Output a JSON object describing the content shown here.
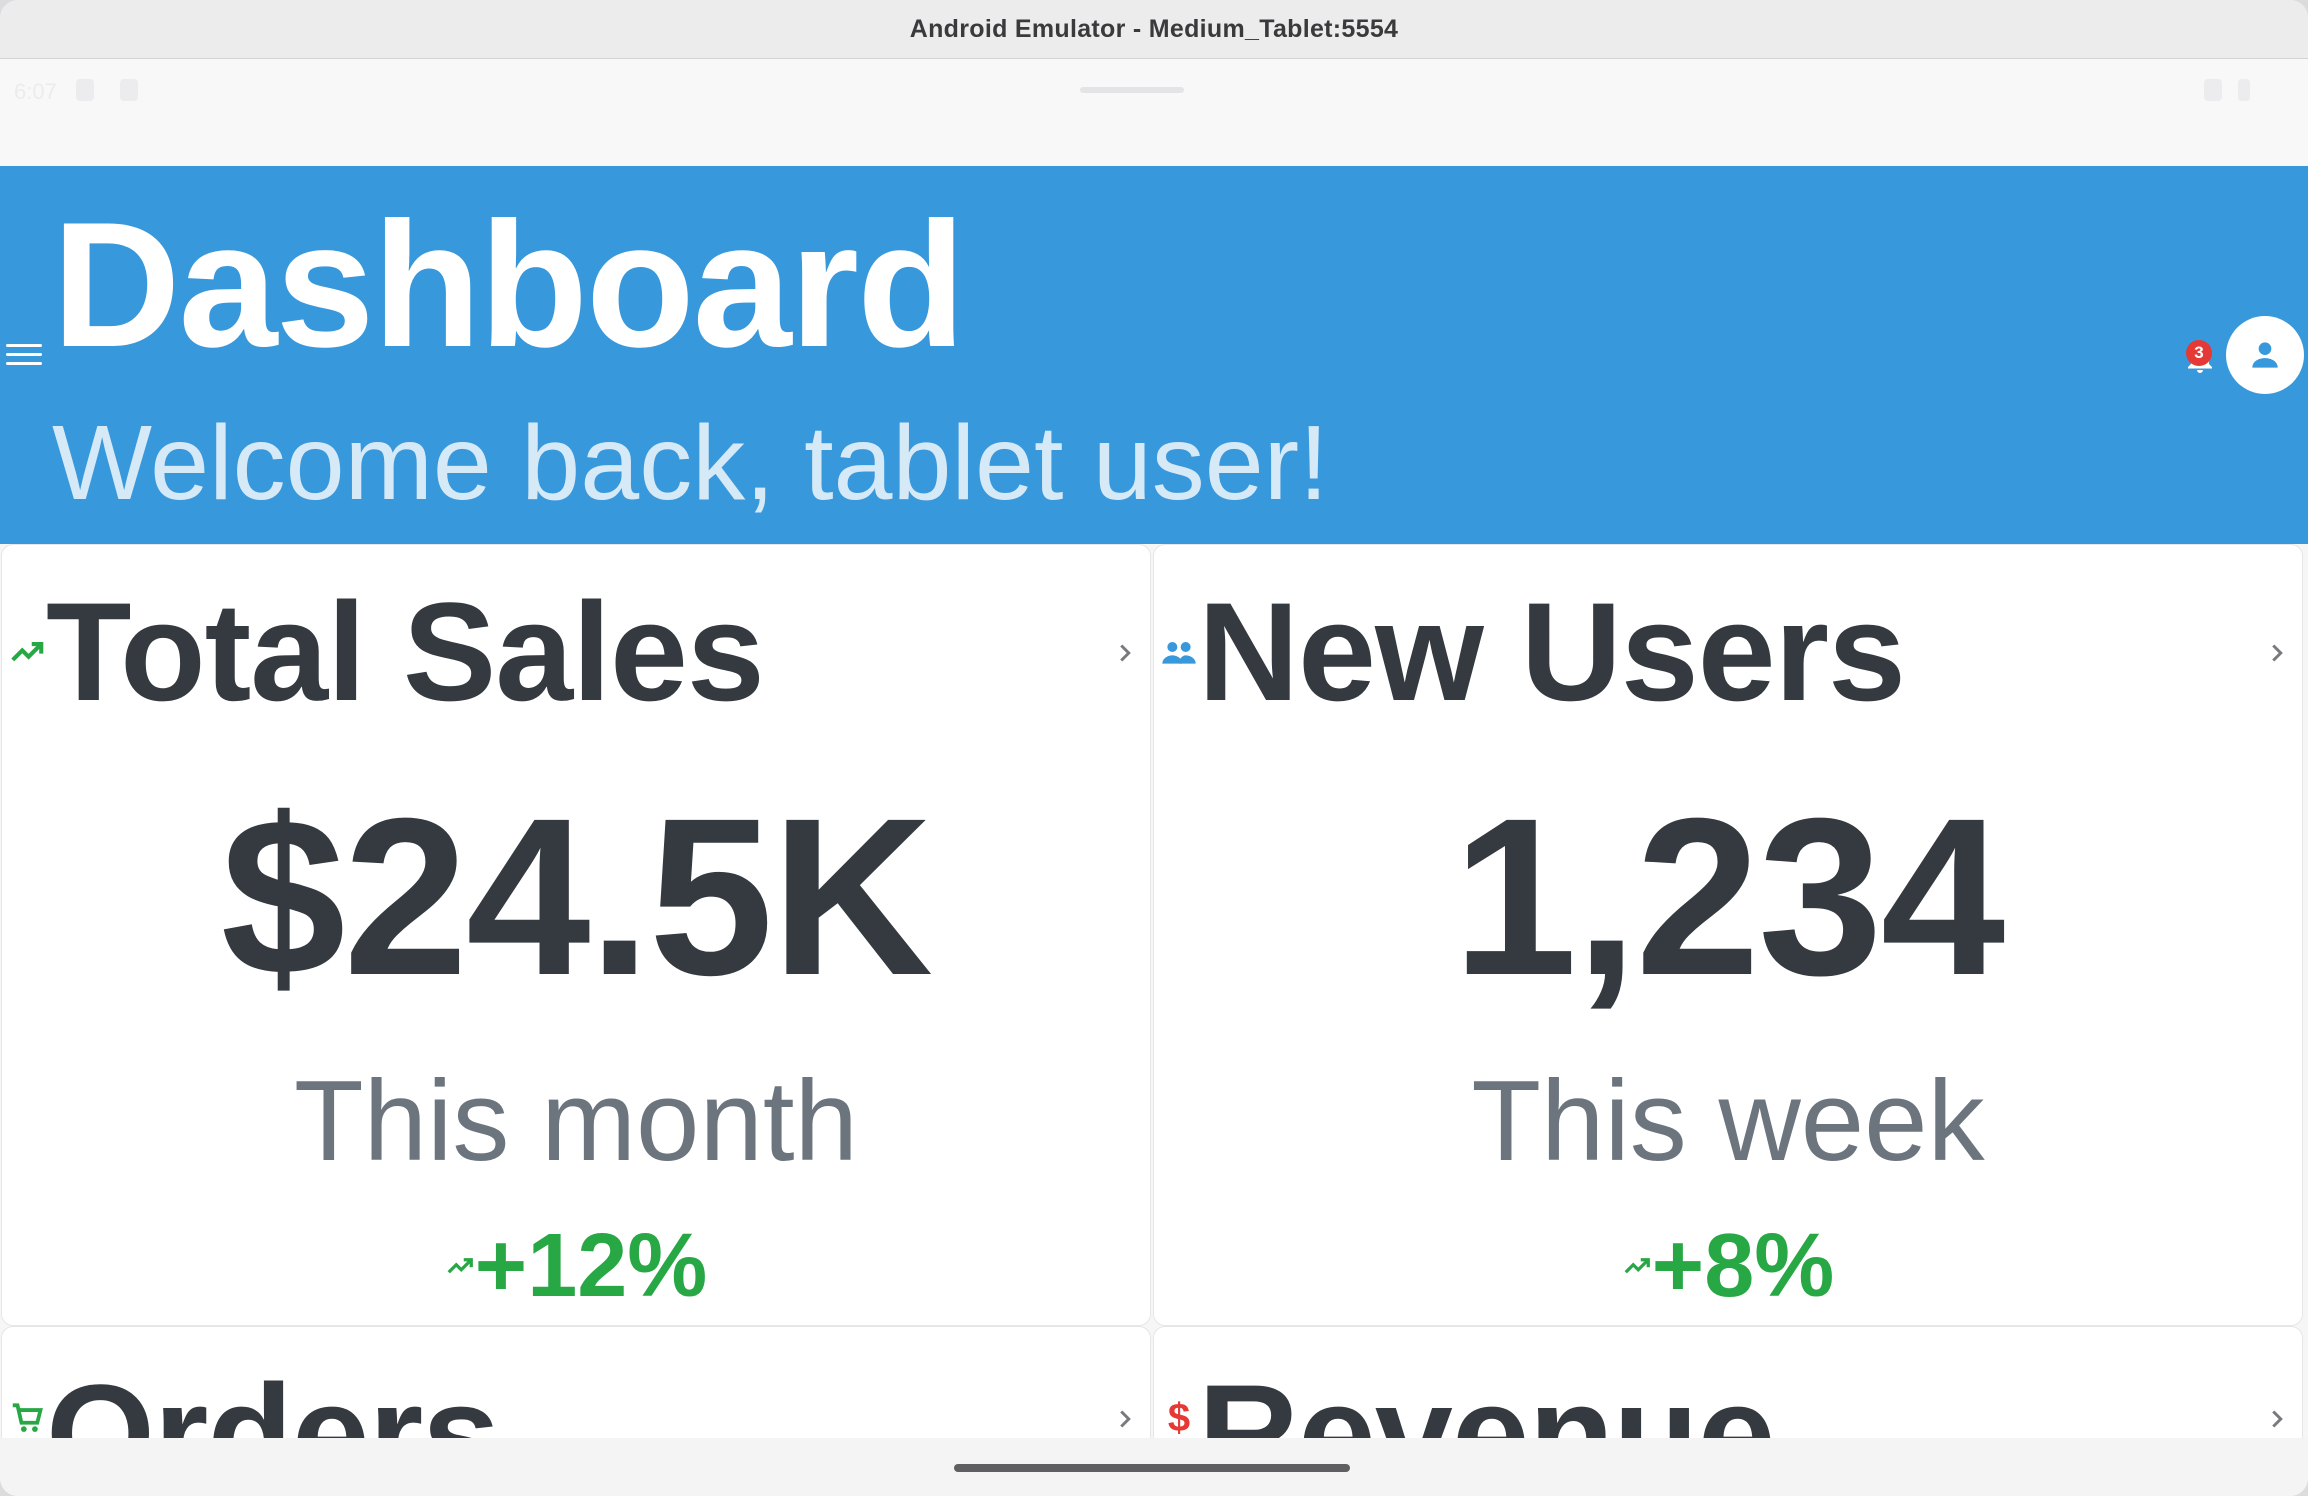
{
  "window": {
    "title": "Android Emulator - Medium_Tablet:5554"
  },
  "statusbar": {
    "time": "6:07"
  },
  "header": {
    "title": "Dashboard",
    "subtitle": "Welcome back, tablet user!",
    "notification_count": "3",
    "colors": {
      "background": "#3898dc"
    }
  },
  "cards": [
    {
      "title": "Total Sales",
      "icon": "trending-up-icon",
      "value": "$24.5K",
      "period": "This month",
      "trend": "+12%"
    },
    {
      "title": "New Users",
      "icon": "people-icon",
      "value": "1,234",
      "period": "This week",
      "trend": "+8%"
    },
    {
      "title": "Orders",
      "icon": "cart-icon"
    },
    {
      "title": "Revenue",
      "icon": "dollar-icon"
    }
  ],
  "colors": {
    "positive": "#28a745",
    "text_dark": "#343a40",
    "text_muted": "#6c757d",
    "badge": "#e53935"
  }
}
